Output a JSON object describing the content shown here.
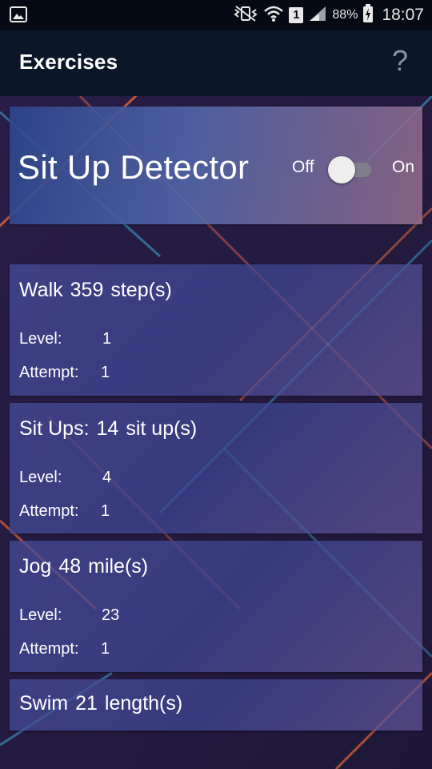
{
  "status_bar": {
    "battery": "88%",
    "sim_slot": "1",
    "time": "18:07"
  },
  "app_bar": {
    "title": "Exercises",
    "help": "?"
  },
  "detector": {
    "title": "Sit Up Detector",
    "off_label": "Off",
    "on_label": "On",
    "enabled": false
  },
  "exercises": [
    {
      "name": "Walk",
      "amount": "359",
      "unit": "step(s)",
      "level_label": "Level:",
      "level": "1",
      "attempt_label": "Attempt:",
      "attempt": "1"
    },
    {
      "name": "Sit Ups:",
      "amount": "14",
      "unit": "sit up(s)",
      "level_label": "Level:",
      "level": "4",
      "attempt_label": "Attempt:",
      "attempt": "1"
    },
    {
      "name": "Jog",
      "amount": "48",
      "unit": "mile(s)",
      "level_label": "Level:",
      "level": "23",
      "attempt_label": "Attempt:",
      "attempt": "1"
    },
    {
      "name": "Swim",
      "amount": "21",
      "unit": "length(s)"
    }
  ]
}
